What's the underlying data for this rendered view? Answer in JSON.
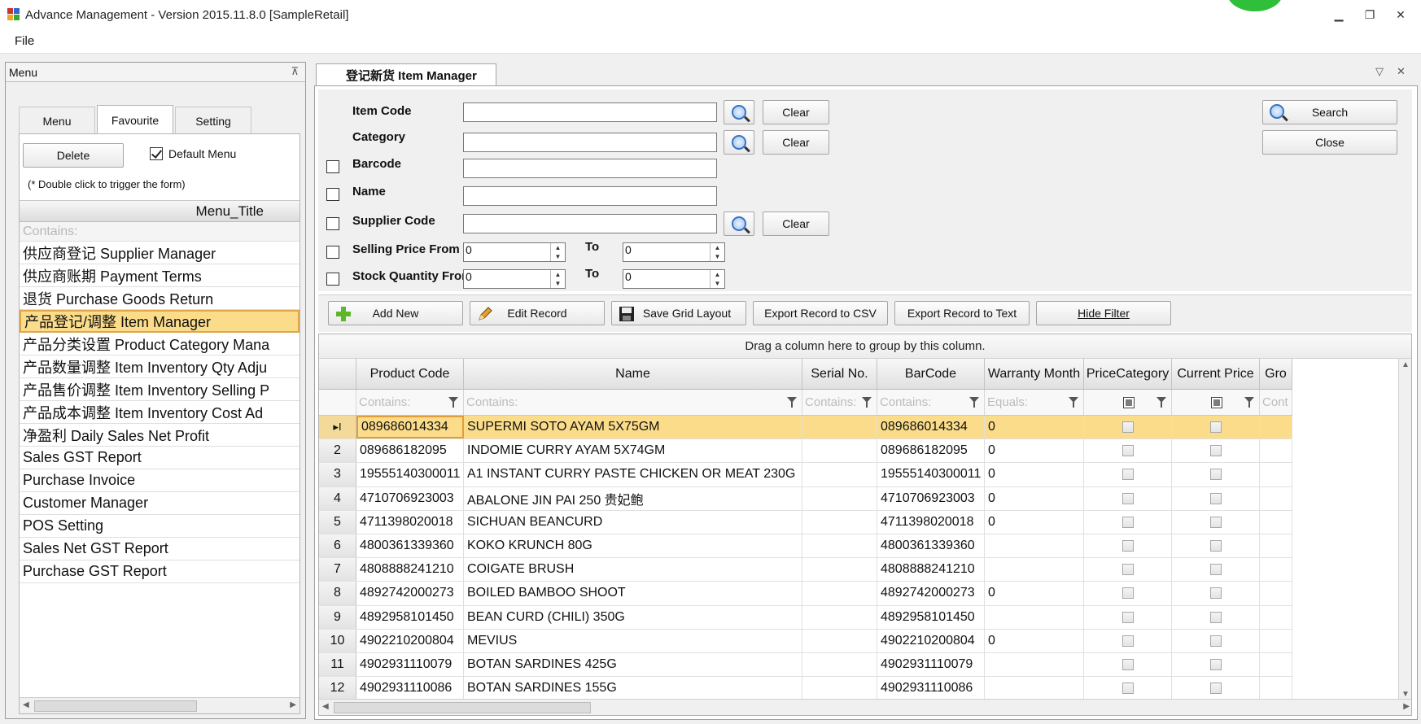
{
  "window": {
    "title": "Advance Management - Version 2015.11.8.0 [SampleRetail]",
    "minimize": "▁",
    "restore": "❐",
    "close": "✕"
  },
  "menubar": {
    "file": "File"
  },
  "left_panel": {
    "title": "Menu",
    "pin": "⊼",
    "tabs": [
      {
        "label": "Menu",
        "active": false
      },
      {
        "label": "Favourite",
        "active": true
      },
      {
        "label": "Setting",
        "active": false
      }
    ],
    "delete_label": "Delete",
    "default_menu_label": "Default Menu",
    "hint": "(* Double click to trigger the form)",
    "column_title": "Menu_Title",
    "filter_placeholder": "Contains:",
    "items": [
      "供应商登记 Supplier Manager",
      "供应商账期 Payment Terms",
      "退货 Purchase Goods Return",
      "产品登记/调整 Item Manager",
      "产品分类设置 Product Category Mana",
      "产品数量调整 Item Inventory Qty Adju",
      "产品售价调整 Item Inventory Selling P",
      "产品成本调整 Item Inventory Cost Ad",
      "净盈利 Daily Sales Net Profit",
      "Sales GST Report",
      "Purchase Invoice",
      "Customer Manager",
      "POS Setting",
      "Sales Net GST Report",
      "Purchase GST Report"
    ],
    "selected_index": 3
  },
  "doc": {
    "tab_label": "登记新货 Item Manager",
    "ctl_dropdown": "▽",
    "ctl_close": "✕"
  },
  "filters": {
    "item_code_label": "Item Code",
    "category_label": "Category",
    "barcode_label": "Barcode",
    "name_label": "Name",
    "supplier_code_label": "Supplier Code",
    "selling_price_from_label": "Selling Price From",
    "stock_quantity_from_label": "Stock Quantity From",
    "to_label": "To",
    "clear_label": "Clear",
    "search_label": "Search",
    "close_label": "Close",
    "selling_price_from": "0",
    "selling_price_to": "0",
    "stock_quantity_from": "0",
    "stock_quantity_to": "0"
  },
  "toolbar": {
    "add_new": "Add New",
    "edit_record": "Edit Record",
    "save_grid_layout": "Save Grid Layout",
    "export_csv": "Export Record to CSV",
    "export_text": "Export Record to Text",
    "hide_filter": "Hide Filter"
  },
  "grid": {
    "group_panel_text": "Drag a column here to group by this column.",
    "columns": [
      "Product Code",
      "Name",
      "Serial No.",
      "BarCode",
      "Warranty Month",
      "PriceCategory",
      "Current Price",
      "Gro"
    ],
    "filter_row": [
      "Contains:",
      "Contains:",
      "Contains:",
      "Contains:",
      "Equals:",
      "",
      "",
      "Cont"
    ],
    "rows": [
      {
        "n": "",
        "code": "089686014334",
        "name": "SUPERMI SOTO AYAM 5X75GM",
        "serial": "",
        "barcode": "089686014334",
        "warranty": "0"
      },
      {
        "n": "2",
        "code": "089686182095",
        "name": "INDOMIE CURRY AYAM 5X74GM",
        "serial": "",
        "barcode": "089686182095",
        "warranty": "0"
      },
      {
        "n": "3",
        "code": "19555140300011",
        "name": "A1 INSTANT CURRY PASTE CHICKEN OR MEAT  230G",
        "serial": "",
        "barcode": "19555140300011",
        "warranty": "0"
      },
      {
        "n": "4",
        "code": "4710706923003",
        "name": "ABALONE JIN PAI 250 贵妃鲍",
        "serial": "",
        "barcode": "4710706923003",
        "warranty": "0"
      },
      {
        "n": "5",
        "code": "4711398020018",
        "name": "SICHUAN BEANCURD",
        "serial": "",
        "barcode": "4711398020018",
        "warranty": "0"
      },
      {
        "n": "6",
        "code": "4800361339360",
        "name": "KOKO KRUNCH 80G",
        "serial": "",
        "barcode": "4800361339360",
        "warranty": ""
      },
      {
        "n": "7",
        "code": "4808888241210",
        "name": "COIGATE BRUSH",
        "serial": "",
        "barcode": "4808888241210",
        "warranty": ""
      },
      {
        "n": "8",
        "code": "4892742000273",
        "name": "BOILED BAMBOO SHOOT",
        "serial": "",
        "barcode": "4892742000273",
        "warranty": "0"
      },
      {
        "n": "9",
        "code": "4892958101450",
        "name": "BEAN CURD (CHILI) 350G",
        "serial": "",
        "barcode": "4892958101450",
        "warranty": ""
      },
      {
        "n": "10",
        "code": "4902210200804",
        "name": "MEVIUS",
        "serial": "",
        "barcode": "4902210200804",
        "warranty": "0"
      },
      {
        "n": "11",
        "code": "4902931110079",
        "name": "BOTAN SARDINES 425G",
        "serial": "",
        "barcode": "4902931110079",
        "warranty": ""
      },
      {
        "n": "12",
        "code": "4902931110086",
        "name": "BOTAN SARDINES 155G",
        "serial": "",
        "barcode": "4902931110086",
        "warranty": ""
      }
    ],
    "selected_row": 0
  }
}
